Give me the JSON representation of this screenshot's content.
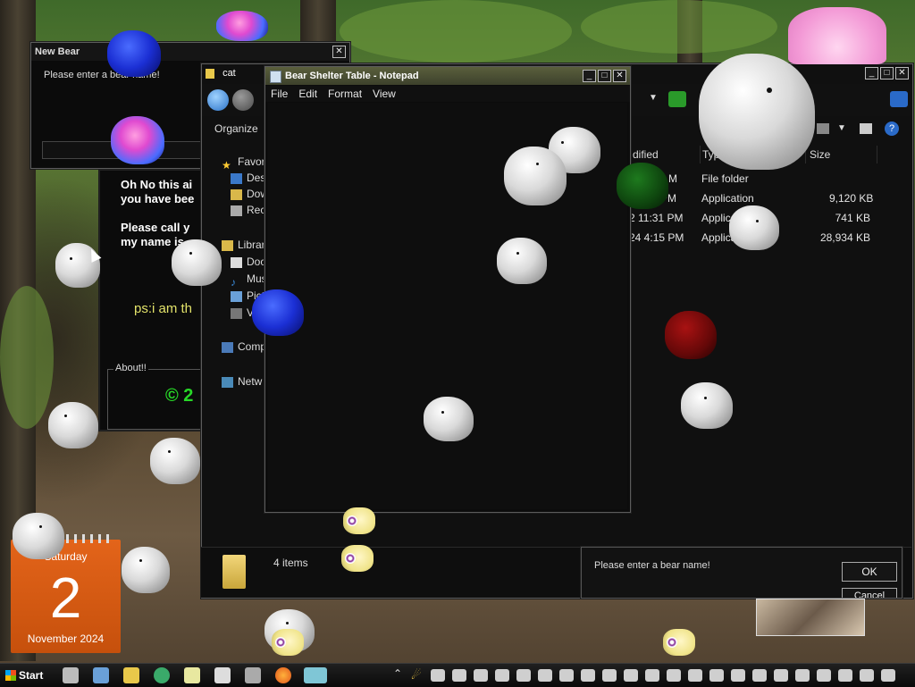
{
  "new_bear_dialog": {
    "title": "New Bear",
    "prompt": "Please enter a bear name!",
    "close": "✕"
  },
  "main_app": {
    "line1": "Oh No this ai",
    "line2": "you have bee",
    "line3": "Please call y",
    "line4": "my name is",
    "ps": "ps:i am th",
    "about_label": "About!!",
    "copyright": "© 2"
  },
  "explorer": {
    "title": "cat",
    "organize": "Organize",
    "nav": [
      "Favor",
      "Desk",
      "Dow",
      "Rec",
      "Librar",
      "Doc",
      "Mus",
      "Pict",
      "Vi",
      "Comp",
      "Netw"
    ],
    "columns": [
      "dified",
      "Type",
      "Size"
    ],
    "rows": [
      {
        "modified": "M",
        "type": "File folder",
        "size": ""
      },
      {
        "modified": "PM",
        "type": "Application",
        "size": "9,120 KB"
      },
      {
        "modified": "2 11:31 PM",
        "type": "Applica",
        "size": "741 KB"
      },
      {
        "modified": "24 4:15 PM",
        "type": "Applica",
        "size": "28,934 KB"
      }
    ],
    "item_count": "4 items"
  },
  "notepad": {
    "title": "Bear Shelter Table - Notepad",
    "menu": [
      "File",
      "Edit",
      "Format",
      "View"
    ]
  },
  "prompt_dialog": {
    "message": "Please enter a bear name!",
    "ok": "OK",
    "cancel": "Cancel"
  },
  "calendar": {
    "weekday": "Saturday",
    "day": "2",
    "month_year": "November 2024"
  },
  "taskbar": {
    "start": "Start"
  },
  "colors": {
    "lime_text": "#e3e36a",
    "green_copyright": "#27d827",
    "notepad_title_bg": "#5a5f3c",
    "calendar_bg": "#e3641a"
  }
}
